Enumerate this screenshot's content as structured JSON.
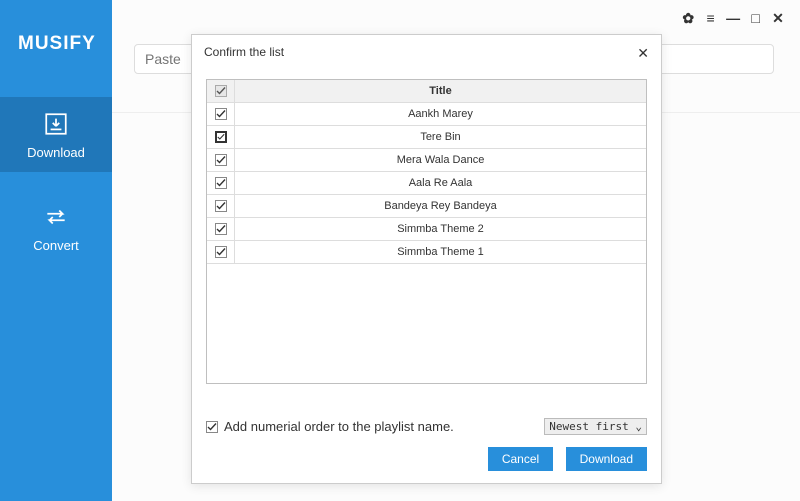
{
  "app": {
    "name": "MUSIFY"
  },
  "sidebar": {
    "download": "Download",
    "convert": "Convert"
  },
  "toolbar": {
    "paste_placeholder": "Paste"
  },
  "dialog": {
    "title": "Confirm the list",
    "table_header": "Title",
    "items": [
      {
        "title": "Aankh Marey",
        "checked": true
      },
      {
        "title": "Tere Bin",
        "checked": true
      },
      {
        "title": "Mera Wala Dance",
        "checked": true
      },
      {
        "title": "Aala Re Aala",
        "checked": true
      },
      {
        "title": "Bandeya Rey Bandeya",
        "checked": true
      },
      {
        "title": "Simmba Theme 2",
        "checked": true
      },
      {
        "title": "Simmba Theme 1",
        "checked": true
      }
    ],
    "footer_label": "Add numerial order to the playlist name.",
    "sort_selected": "Newest first",
    "cancel": "Cancel",
    "download": "Download"
  }
}
